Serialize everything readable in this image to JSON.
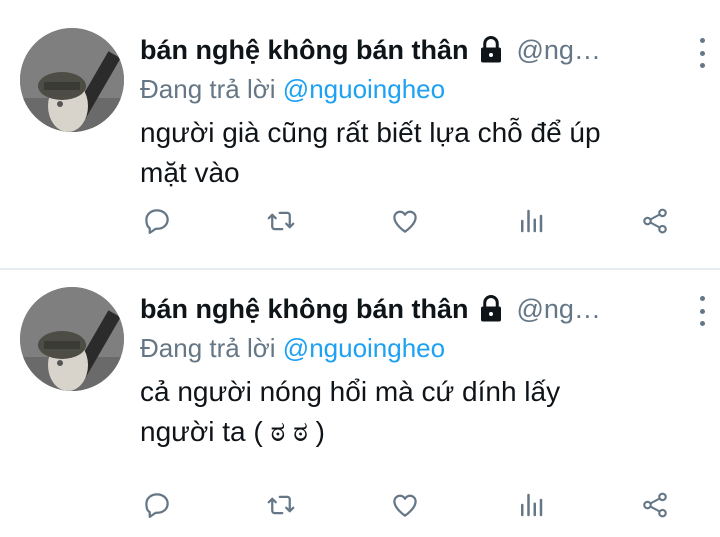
{
  "tweets": [
    {
      "author_name": "bán nghệ không bán thân",
      "handle": "@ng…",
      "reply_prefix": "Đang trả lời",
      "reply_to": "@nguoingheo",
      "text_line1": "người già cũng rất biết lựa chỗ để úp",
      "text_line2": "mặt vào"
    },
    {
      "author_name": "bán nghệ không bán thân",
      "handle": "@ng…",
      "reply_prefix": "Đang trả lời",
      "reply_to": "@nguoingheo",
      "text_line1": "cả người nóng hổi mà cứ dính lấy",
      "text_line2": "người ta ( ಠ ಠ )"
    }
  ],
  "icons": {
    "lock": "lock-icon",
    "more": "more-vertical-icon",
    "reply": "reply-icon",
    "retweet": "retweet-icon",
    "like": "heart-icon",
    "analytics": "analytics-icon",
    "share": "share-icon"
  },
  "colors": {
    "text": "#0f1419",
    "secondary": "#657786",
    "mention": "#1da1f2",
    "divider": "#e6ecf0"
  }
}
